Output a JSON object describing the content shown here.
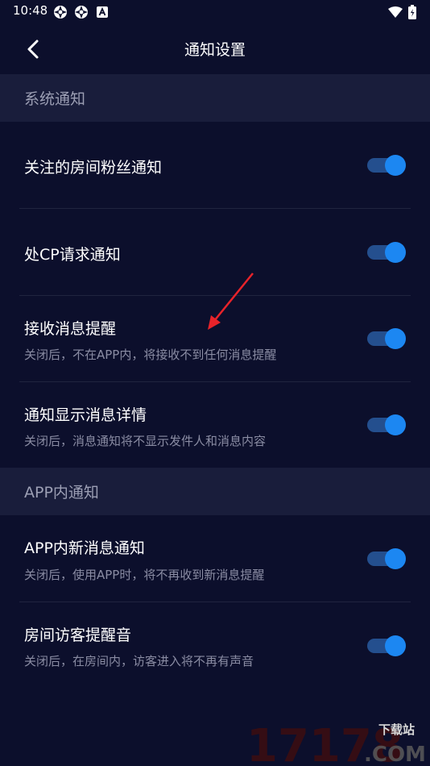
{
  "status_bar": {
    "time": "10:48",
    "icons": [
      "aperture-icon",
      "aperture-icon",
      "notification-a-icon",
      "wifi-icon",
      "battery-icon"
    ]
  },
  "header": {
    "back_icon": "chevron-left-icon",
    "title": "通知设置"
  },
  "sections": [
    {
      "label": "系统通知",
      "items": [
        {
          "title": "关注的房间粉丝通知",
          "subtitle": "",
          "enabled": true
        },
        {
          "title": "处CP请求通知",
          "subtitle": "",
          "enabled": true
        },
        {
          "title": "接收消息提醒",
          "subtitle": "关闭后，不在APP内，将接收不到任何消息提醒",
          "enabled": true
        },
        {
          "title": "通知显示消息详情",
          "subtitle": "关闭后，消息通知将不显示发件人和消息内容",
          "enabled": true
        }
      ]
    },
    {
      "label": "APP内通知",
      "items": [
        {
          "title": "APP内新消息通知",
          "subtitle": "关闭后，使用APP时，将不再收到新消息提醒",
          "enabled": true
        },
        {
          "title": "房间访客提醒音",
          "subtitle": "关闭后，在房间内，访客进入将不再有声音",
          "enabled": true
        }
      ]
    }
  ],
  "watermark": {
    "number": "17178",
    "tag": "下载站",
    "domain": ".COM"
  },
  "colors": {
    "background": "#0c0f2c",
    "section_background": "#191d3b",
    "toggle_knob": "#1c87f2",
    "toggle_track": "#244f8e",
    "annotation_arrow": "#e8232a"
  }
}
